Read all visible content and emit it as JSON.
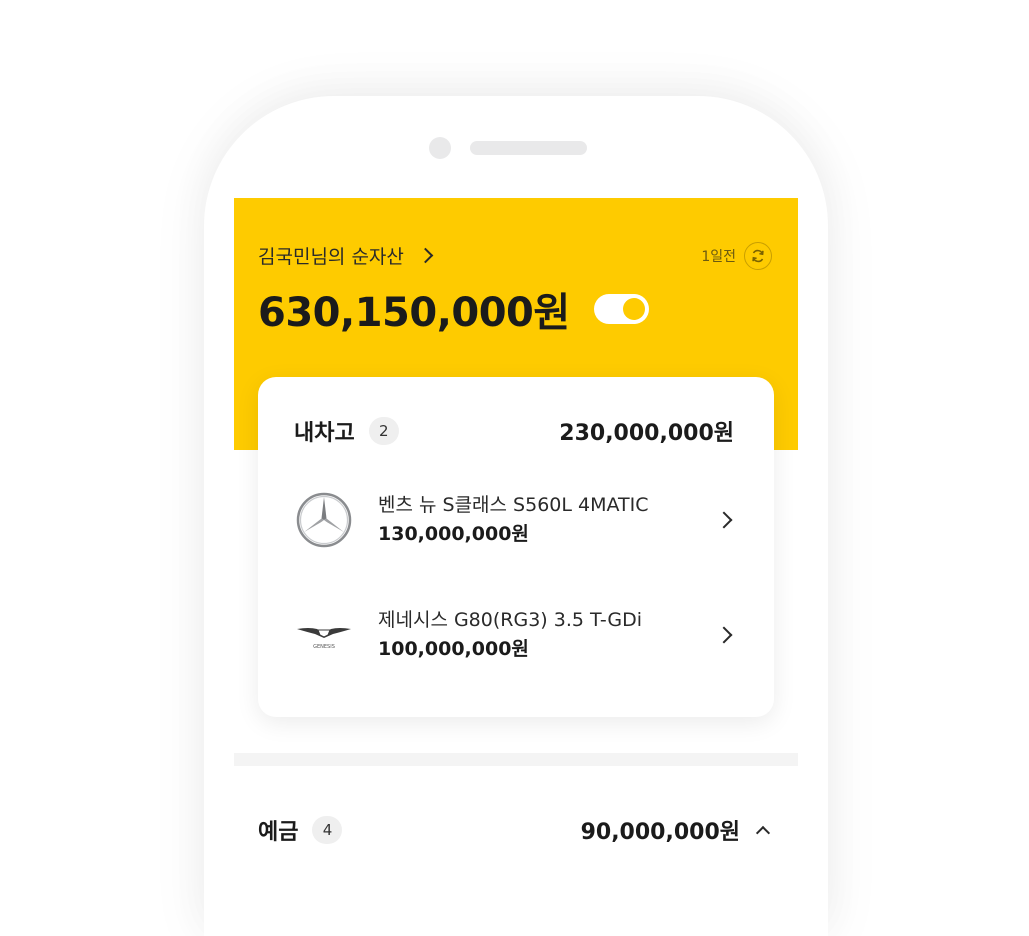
{
  "header": {
    "owner_label": "김국민님의 순자산",
    "updated_label": "1일전",
    "total_amount": "630,150,000원",
    "hide_toggle_on": true
  },
  "garage": {
    "title": "내차고",
    "count": "2",
    "total": "230,000,000원",
    "cars": [
      {
        "name": "벤츠 뉴 S클래스 S560L 4MATIC",
        "price": "130,000,000원",
        "logo": "mercedes-logo"
      },
      {
        "name": "제네시스 G80(RG3) 3.5 T-GDi",
        "price": "100,000,000원",
        "logo": "genesis-logo",
        "logo_text": "GENESIS"
      }
    ]
  },
  "deposit": {
    "title": "예금",
    "count": "4",
    "total": "90,000,000원"
  },
  "colors": {
    "accent": "#fecb00",
    "text": "#1b1b1b"
  }
}
